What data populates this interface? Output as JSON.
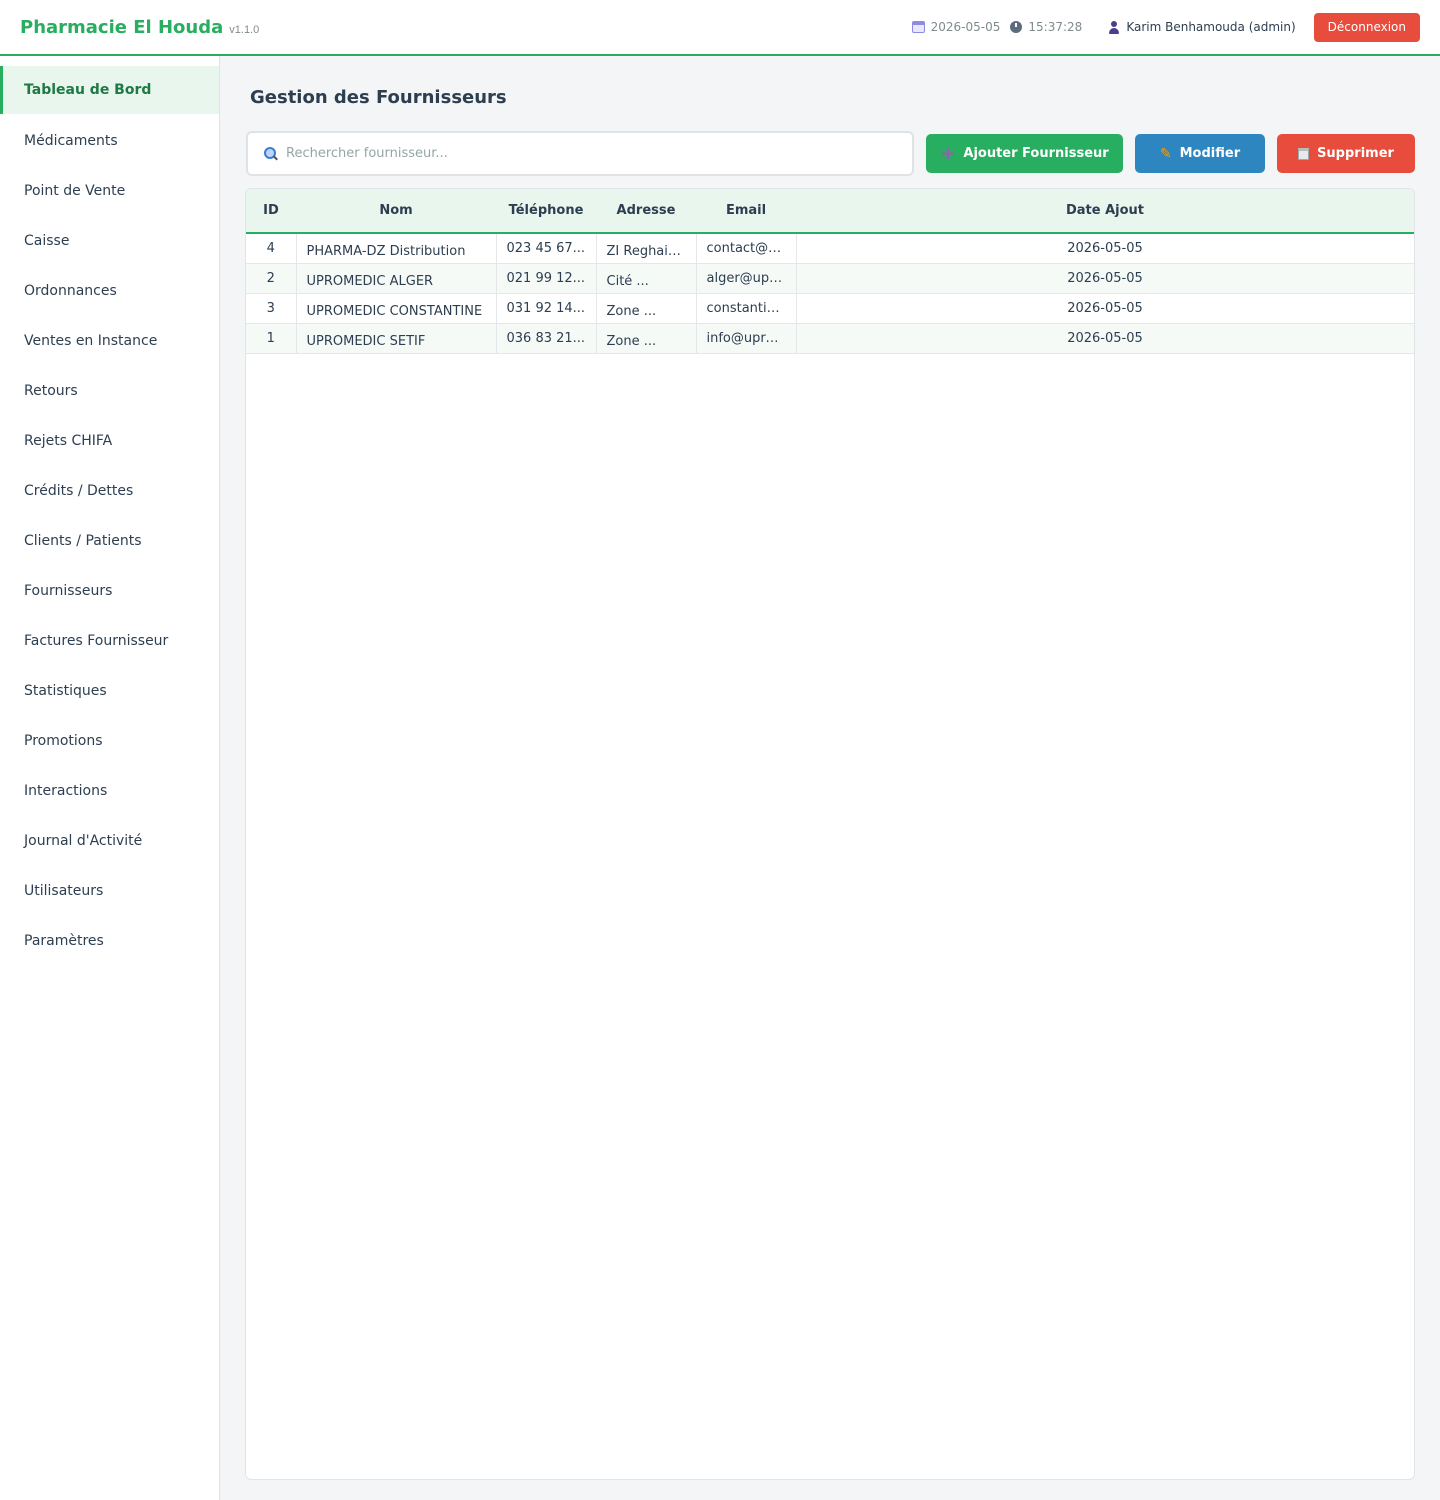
{
  "header": {
    "brand": "Pharmacie El Houda",
    "version": "v1.1.0",
    "date": "2026-05-05",
    "time": "15:37:28",
    "user": "Karim Benhamouda (admin)",
    "logout_label": "Déconnexion"
  },
  "sidebar": {
    "items": [
      {
        "label": "Tableau de Bord"
      },
      {
        "label": "Médicaments"
      },
      {
        "label": "Point de Vente"
      },
      {
        "label": "Caisse"
      },
      {
        "label": "Ordonnances"
      },
      {
        "label": "Ventes en Instance"
      },
      {
        "label": "Retours"
      },
      {
        "label": "Rejets CHIFA"
      },
      {
        "label": "Crédits / Dettes"
      },
      {
        "label": "Clients / Patients"
      },
      {
        "label": "Fournisseurs"
      },
      {
        "label": "Factures Fournisseur"
      },
      {
        "label": "Statistiques"
      },
      {
        "label": "Promotions"
      },
      {
        "label": "Interactions"
      },
      {
        "label": "Journal d'Activité"
      },
      {
        "label": "Utilisateurs"
      },
      {
        "label": "Paramètres"
      }
    ],
    "active_index": 0
  },
  "main": {
    "title": "Gestion des Fournisseurs",
    "search": {
      "placeholder": "Rechercher fournisseur...",
      "value": ""
    },
    "buttons": {
      "add": "Ajouter Fournisseur",
      "edit": "Modifier",
      "delete": "Supprimer"
    },
    "table": {
      "columns": [
        "ID",
        "Nom",
        "Téléphone",
        "Adresse",
        "Email",
        "Date Ajout"
      ],
      "rows": [
        {
          "id": "4",
          "nom": "PHARMA-DZ Distribution",
          "telephone": "023 45 67...",
          "adresse": "ZI Reghaia...",
          "email": "contact@p...",
          "date": "2026-05-05"
        },
        {
          "id": "2",
          "nom": "UPROMEDIC ALGER",
          "telephone": "021 99 12...",
          "adresse": "Cité ...",
          "email": "alger@upr...",
          "date": "2026-05-05"
        },
        {
          "id": "3",
          "nom": "UPROMEDIC CONSTANTINE",
          "telephone": "031 92 14...",
          "adresse": "Zone ...",
          "email": "constantin...",
          "date": "2026-05-05"
        },
        {
          "id": "1",
          "nom": "UPROMEDIC SETIF",
          "telephone": "036 83 21...",
          "adresse": "Zone ...",
          "email": "info@upro...",
          "date": "2026-05-05"
        }
      ]
    }
  },
  "colors": {
    "accent": "#27ae60",
    "edit": "#2e86c1",
    "danger": "#e74c3c"
  }
}
